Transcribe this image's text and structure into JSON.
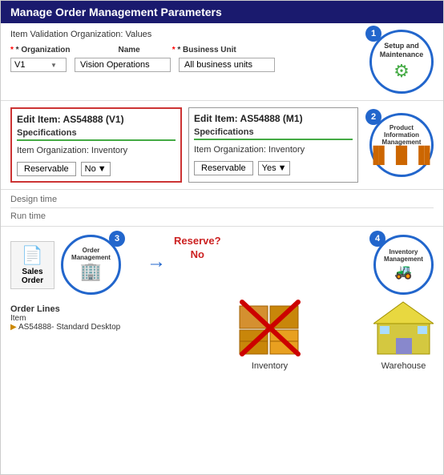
{
  "title": "Manage Order Management Parameters",
  "subtitle": "Item Validation Organization: Values",
  "form": {
    "org_label": "* Organization",
    "name_label": "Name",
    "bu_label": "* Business Unit",
    "org_value": "V1",
    "name_value": "Vision Operations",
    "bu_value": "All business units"
  },
  "circle1": {
    "number": "1",
    "line1": "Setup and",
    "line2": "Maintenance"
  },
  "edit_item_v1": {
    "title": "Edit Item: AS54888 (V1)",
    "specs": "Specifications",
    "org": "Item Organization: Inventory",
    "reservable_label": "Reservable",
    "reservable_value": "No"
  },
  "edit_item_m1": {
    "title": "Edit Item: AS54888 (M1)",
    "specs": "Specifications",
    "org": "Item Organization: Inventory",
    "reservable_label": "Reservable",
    "reservable_value": "Yes"
  },
  "circle2": {
    "number": "2",
    "line1": "Product",
    "line2": "Information",
    "line3": "Management"
  },
  "design_time": "Design time",
  "run_time": "Run time",
  "sales_order": {
    "label": "Sales Order"
  },
  "circle3": {
    "number": "3",
    "line1": "Order",
    "line2": "Management"
  },
  "order_lines": {
    "title": "Order Lines",
    "item_label": "Item",
    "item_value": "AS54888- Standard Desktop"
  },
  "reserve_question": "Reserve?",
  "reserve_answer": "No",
  "circle4": {
    "number": "4",
    "line1": "Inventory",
    "line2": "Management"
  },
  "inventory_label": "Inventory",
  "warehouse_label": "Warehouse"
}
